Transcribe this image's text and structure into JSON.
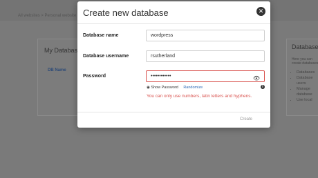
{
  "background": {
    "breadcrumb": "All websites  >  Personal website",
    "left_card": {
      "title": "My Database",
      "column": "DB Name"
    },
    "right_card": {
      "title": "Database",
      "intro": "Here you can create databases",
      "bullets": [
        "Databases",
        "Database users",
        "Manage database",
        "Use local"
      ]
    }
  },
  "modal": {
    "title": "Create new database",
    "fields": {
      "db_name": {
        "label": "Database name",
        "value": "wordpress"
      },
      "db_user": {
        "label": "Database username",
        "value": "rsutherland"
      },
      "password": {
        "label": "Password",
        "value": "••••••••••••"
      }
    },
    "show_password": "Show Password",
    "randomize": "Randomize",
    "error": "You can only use numbers, latin letters and hyphens.",
    "create_label": "Create"
  },
  "colors": {
    "error": "#d9534f",
    "link": "#2c6ab6"
  },
  "icons": {
    "close": "close-circle-icon",
    "eye": "eye-icon",
    "info": "info-icon"
  }
}
